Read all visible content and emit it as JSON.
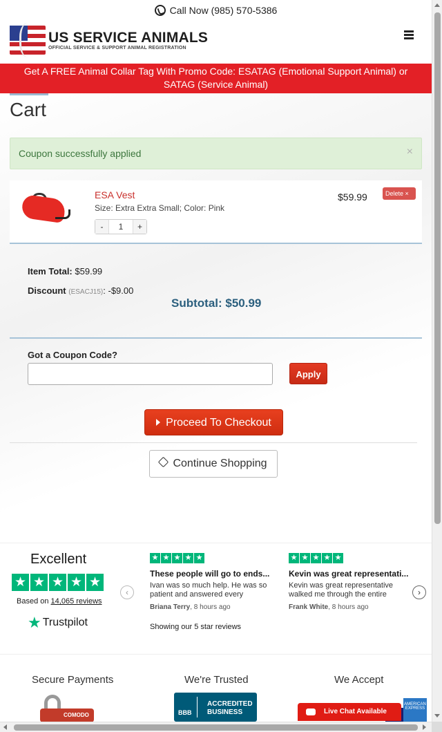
{
  "topbar": {
    "call_text": "Call Now (985) 570-5386"
  },
  "header": {
    "brand": "US SERVICE ANIMALS",
    "tagline": "OFFICIAL SERVICE & SUPPORT ANIMAL REGISTRATION"
  },
  "promo": {
    "text": "Get A FREE Animal Collar Tag With Promo Code: ESATAG (Emotional Support Animal) or SATAG (Service Animal)"
  },
  "cart": {
    "title": "Cart",
    "alert": {
      "message": "Coupon successfully applied",
      "close": "×"
    },
    "item": {
      "name": "ESA Vest",
      "meta": "Size: Extra Extra Small; Color: Pink",
      "qty_minus": "-",
      "qty_value": "1",
      "qty_plus": "+",
      "price": "$59.99",
      "delete_label": "Delete ×"
    },
    "totals": {
      "item_total_label": "Item Total:",
      "item_total_value": "$59.99",
      "discount_label": "Discount",
      "discount_code": "(ESACJ15)",
      "discount_value": ": -$9.00",
      "subtotal": "Subtotal: $50.99"
    },
    "coupon": {
      "label": "Got a Coupon Code?",
      "placeholder": "",
      "value": "",
      "apply": "Apply"
    },
    "checkout": "Proceed To Checkout",
    "continue": "Continue Shopping"
  },
  "trustpilot": {
    "rating_word": "Excellent",
    "based_on": "Based on ",
    "review_count": "14,065 reviews",
    "logo": "Trustpilot",
    "showing": "Showing our 5 star reviews",
    "reviews": [
      {
        "title": "These people will go to ends...",
        "body": "Ivan was so much help. He was so patient and answered every",
        "author": "Briana Terry",
        "time": ", 8 hours ago"
      },
      {
        "title": "Kevin was great representati...",
        "body": "Kevin was great representative walked me through the entire",
        "author": "Frank White",
        "time": ", 8 hours ago"
      }
    ]
  },
  "footer": {
    "secure": "Secure Payments",
    "trusted": "We're Trusted",
    "accept": "We Accept",
    "comodo": "COMODO",
    "bbb_mark": "BBB",
    "bbb_text_1": "ACCREDITED",
    "bbb_text_2": "BUSINESS",
    "amex": "AMERICAN EXPRESS"
  },
  "chat": {
    "label": "Live Chat Available"
  },
  "colors": {
    "brand_red": "#e32026",
    "subtotal_blue": "#2b5f7e",
    "trustpilot_green": "#00b67a"
  }
}
